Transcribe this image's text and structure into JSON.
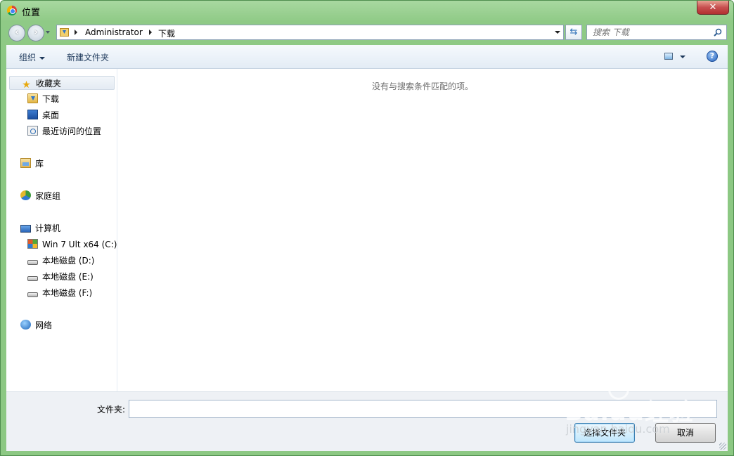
{
  "window": {
    "title": "位置",
    "close_label": "✕"
  },
  "address_bar": {
    "breadcrumbs": [
      "Administrator",
      "下载"
    ]
  },
  "search": {
    "placeholder": "搜索 下载"
  },
  "toolbar": {
    "organize_label": "组织",
    "new_folder_label": "新建文件夹",
    "help_label": "?"
  },
  "nav_pane": {
    "favorites": "收藏夹",
    "downloads": "下载",
    "desktop": "桌面",
    "recent": "最近访问的位置",
    "libraries": "库",
    "homegroup": "家庭组",
    "computer": "计算机",
    "drive_c": "Win 7 Ult x64 (C:)",
    "drive_d": "本地磁盘 (D:)",
    "drive_e": "本地磁盘 (E:)",
    "drive_f": "本地磁盘 (F:)",
    "network": "网络"
  },
  "content": {
    "empty_message": "没有与搜索条件匹配的项。"
  },
  "footer": {
    "folder_label": "文件夹:",
    "folder_value": "",
    "select_button": "选择文件夹",
    "cancel_button": "取消"
  },
  "watermark": {
    "logo_text": "Baidu经验",
    "sub_text": "jingyan.baidu.com"
  },
  "colors": {
    "frame": "#8cc883",
    "toolbar": "#e3ecf5",
    "accent": "#3c7fb1"
  }
}
